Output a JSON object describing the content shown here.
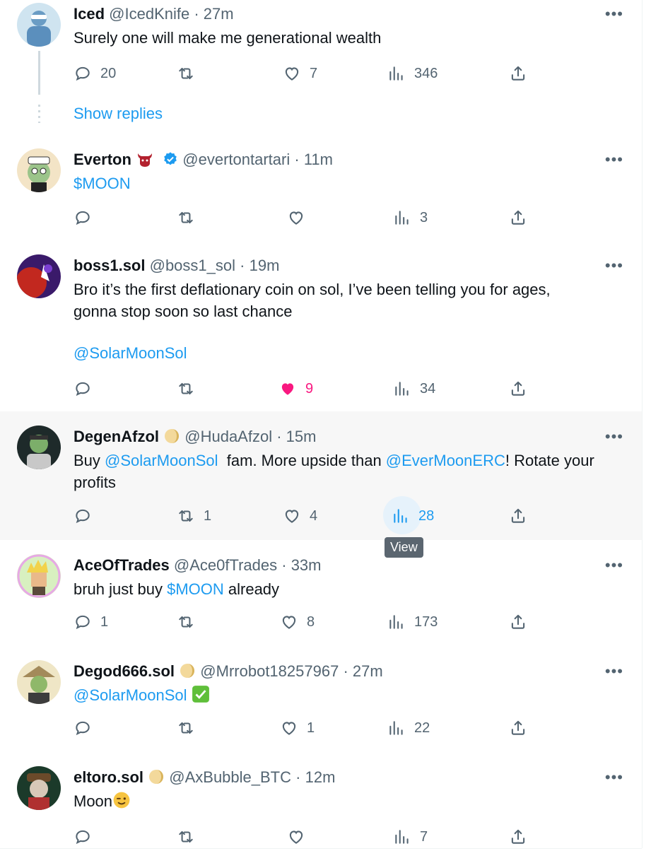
{
  "posts": [
    {
      "name": "Iced",
      "handle": "@IcedKnife",
      "time": "27m",
      "text": "Surely one will make me generational wealth",
      "replies": "20",
      "reposts": "",
      "likes": "7",
      "views": "346",
      "show_replies": "Show replies"
    },
    {
      "name": "Everton",
      "handle": "@evertontartari",
      "time": "11m",
      "text": "$MOON",
      "replies": "",
      "reposts": "",
      "likes": "",
      "views": "3"
    },
    {
      "name": "boss1.sol",
      "handle": "@boss1_sol",
      "time": "19m",
      "text_line1": "Bro it’s the first deflationary coin on sol, I’ve been telling you for ages,",
      "text_line2": "gonna stop soon so last chance",
      "mention": "@SolarMoonSol",
      "replies": "",
      "reposts": "",
      "likes": "9",
      "views": "34"
    },
    {
      "name": "DegenAfzol",
      "handle": "@HudaAfzol",
      "time": "15m",
      "text_prefix": "Buy ",
      "mention1": "@SolarMoonSol",
      "text_mid": "  fam. More upside than ",
      "mention2": "@EverMoonERC",
      "text_suffix": "! Rotate your",
      "text_line2": "profits",
      "replies": "",
      "reposts": "1",
      "likes": "4",
      "views": "28",
      "tooltip": "View"
    },
    {
      "name": "AceOfTrades",
      "handle": "@Ace0fTrades",
      "time": "33m",
      "text_prefix": "bruh just buy ",
      "cashtag": "$MOON",
      "text_suffix": " already",
      "replies": "1",
      "reposts": "",
      "likes": "8",
      "views": "173"
    },
    {
      "name": "Degod666.sol",
      "handle": "@Mrrobot18257967",
      "time": "27m",
      "mention": "@SolarMoonSol",
      "replies": "",
      "reposts": "",
      "likes": "1",
      "views": "22"
    },
    {
      "name": "eltoro.sol",
      "handle": "@AxBubble_BTC",
      "time": "12m",
      "text": "Moon",
      "replies": "",
      "reposts": "",
      "likes": "",
      "views": "7"
    }
  ],
  "separator": "·",
  "more_label": "•••",
  "icons": {
    "reply": "reply-icon",
    "repost": "repost-icon",
    "like": "heart-icon",
    "views": "views-icon",
    "share": "share-icon",
    "verified": "verified-badge-icon"
  },
  "colors": {
    "accent": "#1d9bf0",
    "like_active": "#f91880",
    "muted": "#536471",
    "hover_bg": "#f7f7f7"
  }
}
